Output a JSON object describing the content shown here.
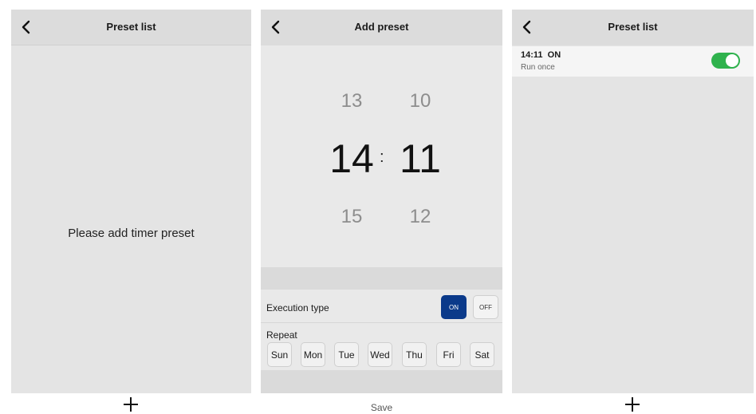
{
  "screens": [
    {
      "header": {
        "title": "Preset list"
      },
      "empty_message": "Please add timer preset"
    },
    {
      "header": {
        "title": "Add preset"
      },
      "picker": {
        "hours": {
          "above": "13",
          "selected": "14",
          "below": "15"
        },
        "minutes": {
          "above": "10",
          "selected": "11",
          "below": "12"
        },
        "separator": ":"
      },
      "execution": {
        "label": "Execution type",
        "on_label": "ON",
        "off_label": "OFF",
        "selected": "ON"
      },
      "repeat": {
        "label": "Repeat",
        "days": [
          "Sun",
          "Mon",
          "Tue",
          "Wed",
          "Thu",
          "Fri",
          "Sat"
        ]
      },
      "save_label": "Save"
    },
    {
      "header": {
        "title": "Preset list"
      },
      "presets": [
        {
          "time": "14:11",
          "state": "ON",
          "subtitle": "Run once",
          "enabled": true
        }
      ]
    }
  ],
  "colors": {
    "accent_on": "#0b3a8a",
    "switch_on": "#2fb24d",
    "panel_bg": "#e4e4e4"
  },
  "icons": {
    "back": "chevron-left-icon",
    "add": "plus-icon"
  }
}
